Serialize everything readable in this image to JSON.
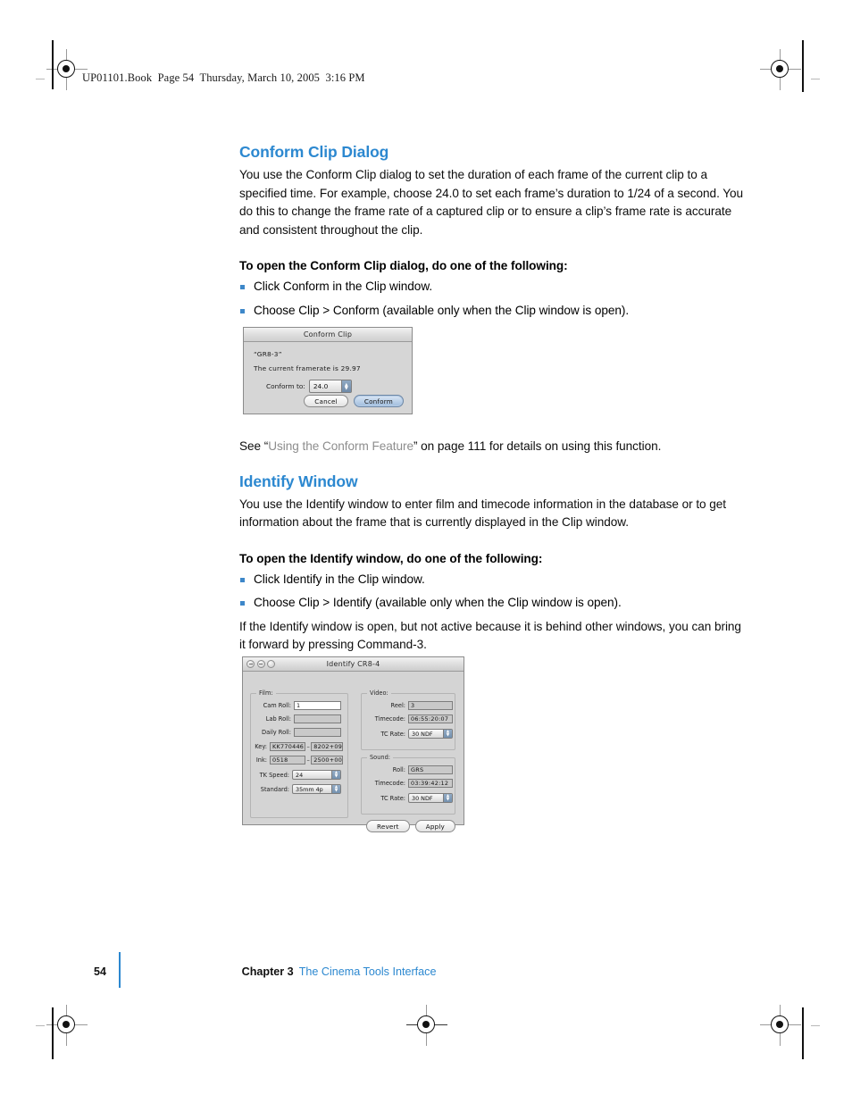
{
  "page_header": "UP01101.Book  Page 54  Thursday, March 10, 2005  3:16 PM",
  "sections": {
    "conform": {
      "title": "Conform Clip Dialog",
      "paragraph": "You use the Conform Clip dialog to set the duration of each frame of the current clip to a specified time. For example, choose 24.0 to set each frame’s duration to 1/24 of a second. You do this to change the frame rate of a captured clip or to ensure a clip’s frame rate is accurate and consistent throughout the clip.",
      "lead_in": "To open the Conform Clip dialog, do one of the following:",
      "bullets": [
        "Click Conform in the Clip window.",
        "Choose Clip > Conform (available only when the Clip window is open)."
      ],
      "see_also": {
        "prefix": "See “",
        "link": "Using the Conform Feature",
        "suffix": "” on page 111 for details on using this function."
      }
    },
    "identify": {
      "title": "Identify Window",
      "paragraph": "You use the Identify window to enter film and timecode information in the database or to get information about the frame that is currently displayed in the Clip window.",
      "lead_in": "To open the Identify window, do one of the following:",
      "bullets": [
        "Click Identify in the Clip window.",
        "Choose Clip > Identify (available only when the Clip window is open)."
      ],
      "note": "If the Identify window is open, but not active because it is behind other windows, you can bring it forward by pressing Command-3."
    }
  },
  "conform_dialog": {
    "window_title": "Conform Clip",
    "clip_name": "“GR8-3”",
    "framerate_text": "The current framerate is 29.97",
    "conform_to_label": "Conform to:",
    "conform_to_value": "24.0",
    "cancel_label": "Cancel",
    "conform_label": "Conform"
  },
  "identify_window": {
    "window_title": "Identify CR8-4",
    "film_group_label": "Film:",
    "video_group_label": "Video:",
    "sound_group_label": "Sound:",
    "film": {
      "cam_roll_label": "Cam Roll:",
      "cam_roll_value": "1",
      "lab_roll_label": "Lab Roll:",
      "lab_roll_value": "",
      "daily_roll_label": "Daily Roll:",
      "daily_roll_value": "",
      "key_label": "Key:",
      "key_value_a": "KK770446",
      "key_value_b": "8202+09",
      "ink_label": "Ink:",
      "ink_value_a": "0518",
      "ink_value_b": "2500+00",
      "tk_speed_label": "TK Speed:",
      "tk_speed_value": "24",
      "standard_label": "Standard:",
      "standard_value": "35mm 4p"
    },
    "video": {
      "reel_label": "Reel:",
      "reel_value": "3",
      "timecode_label": "Timecode:",
      "timecode_value": "06:55:20:07",
      "tc_rate_label": "TC Rate:",
      "tc_rate_value": "30 NDF"
    },
    "sound": {
      "roll_label": "Roll:",
      "roll_value": "GRS",
      "timecode_label": "Timecode:",
      "timecode_value": "03:39:42:12",
      "tc_rate_label": "TC Rate:",
      "tc_rate_value": "30 NDF"
    },
    "revert_label": "Revert",
    "apply_label": "Apply"
  },
  "footer": {
    "page_number": "54",
    "chapter": "Chapter 3",
    "chapter_title": "The Cinema Tools Interface"
  },
  "colors": {
    "heading_blue": "#2c88d0",
    "bullet_blue": "#3d87c9",
    "link_gray": "#8d8d8d"
  }
}
